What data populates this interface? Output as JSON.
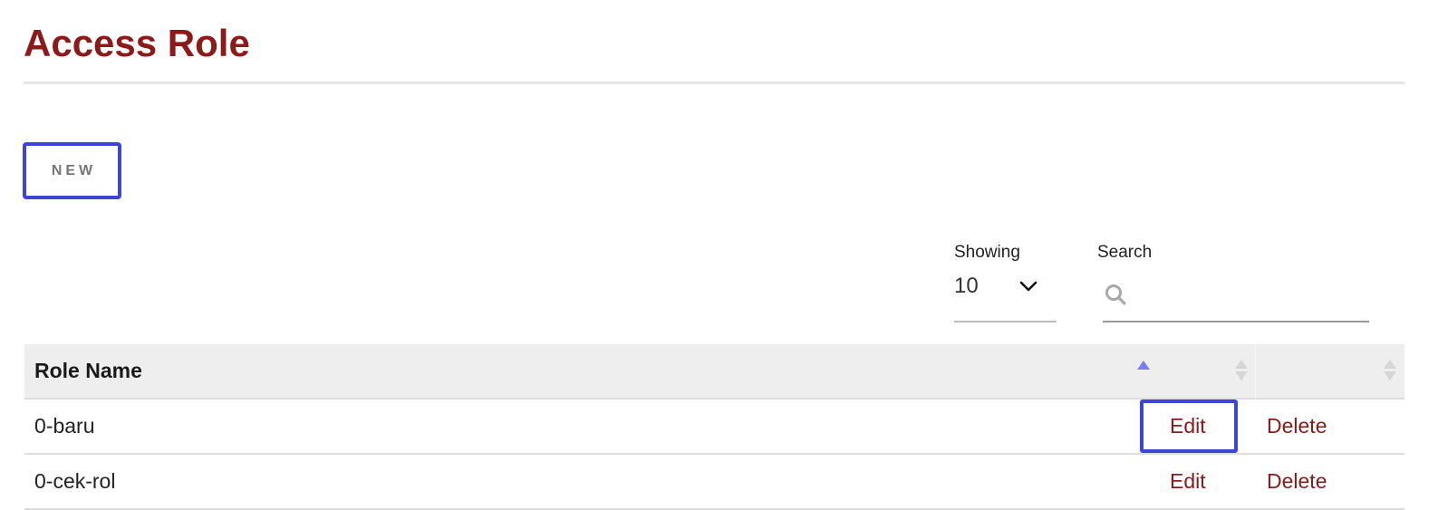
{
  "page": {
    "title": "Access Role"
  },
  "toolbar": {
    "new_label": "NEW"
  },
  "filters": {
    "showing_label": "Showing",
    "showing_value": "10",
    "search_label": "Search",
    "search_placeholder": "",
    "search_value": ""
  },
  "table": {
    "columns": [
      "Role Name",
      "",
      ""
    ],
    "rows": [
      {
        "name": "0-baru",
        "edit": "Edit",
        "delete": "Delete"
      },
      {
        "name": "0-cek-rol",
        "edit": "Edit",
        "delete": "Delete"
      }
    ]
  },
  "colors": {
    "brand": "#8b1a1a",
    "highlight": "#3d45d4",
    "sort_active": "#7a7ff0",
    "header_bg": "#eeeeee"
  },
  "icons": [
    "chevron-down-icon",
    "search-icon",
    "sort-asc-icon",
    "sort-both-icon"
  ]
}
